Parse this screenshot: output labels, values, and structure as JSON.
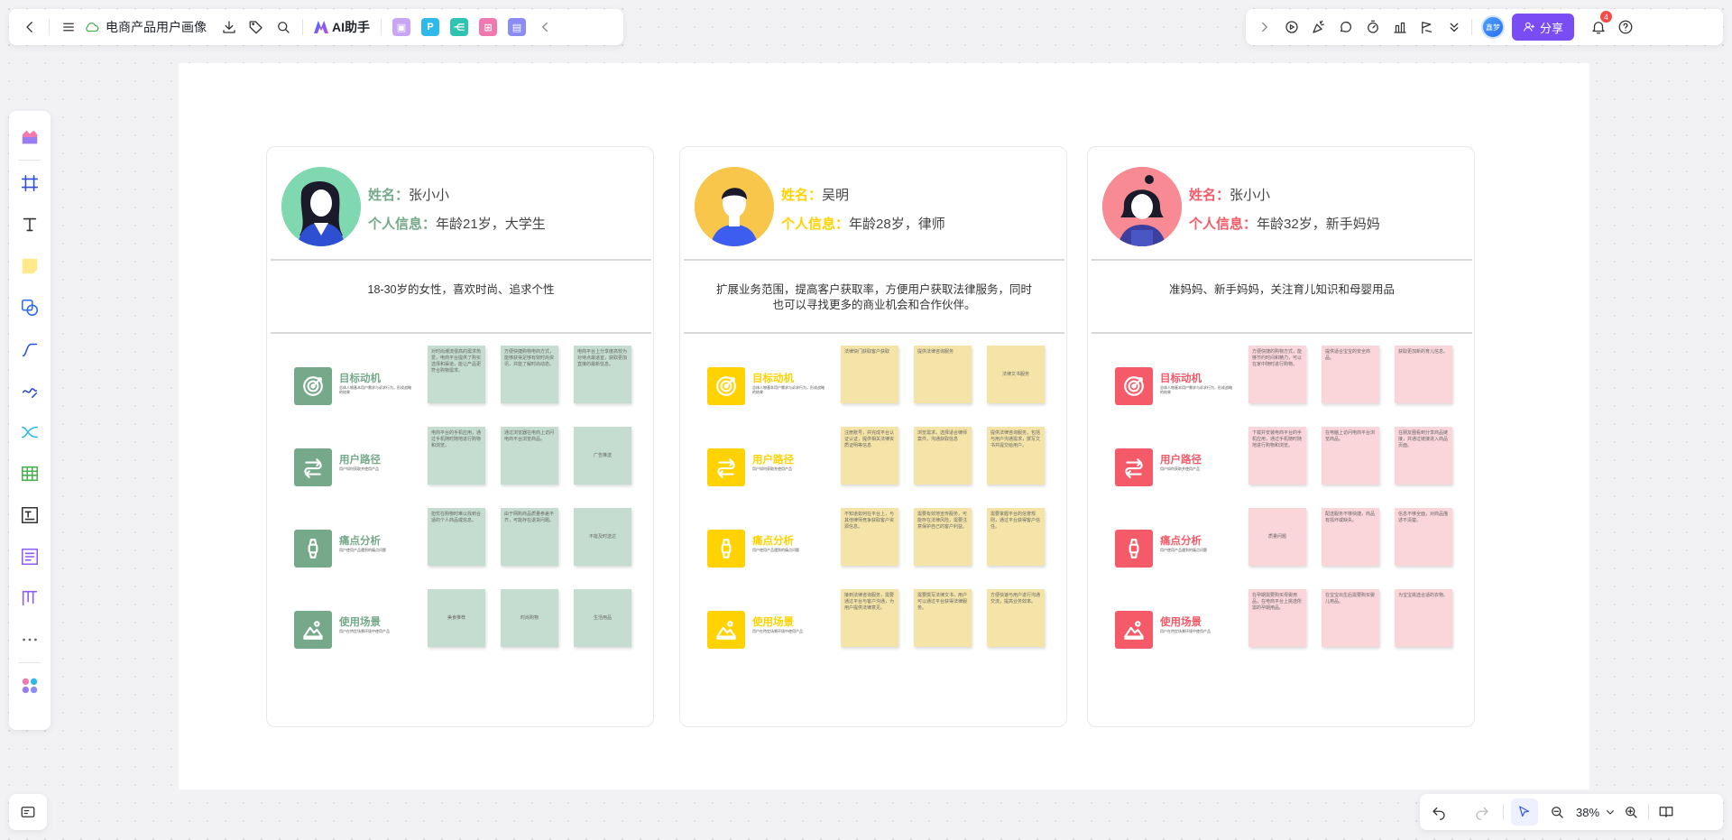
{
  "toolbar": {
    "title": "电商产品用户画像",
    "ai_label": "AI助手",
    "share_label": "分享",
    "avatar_text": "鑫梦",
    "notif_count": "4",
    "zoom": "38%"
  },
  "colors": {
    "green": "#75a98a",
    "yellow": "#ffd200",
    "red": "#f55a68",
    "green_note": "#c5ddd0",
    "yellow_note": "#f5e4a8",
    "red_note": "#fad5da"
  },
  "cards": [
    {
      "name_label": "姓名：",
      "name": "张小小",
      "info_label": "个人信息：",
      "info": "年龄21岁，大学生",
      "desc": "18-30岁的女性，喜欢时尚、追求个性",
      "rows": [
        {
          "title": "目标动机",
          "sub": "总体人物基本用户需求与诉求行为，形成战略的结果",
          "icon": "target-icon",
          "notes": [
            "对时尚潮流很高的需求热爱，电商平台提供了购买选择和渠道，能让产品更符合购物需求。",
            "方便快捷购物电商方式，能够获得足够有效时尚资讯，并能了解时尚动态。",
            "电商平台上分享度高较为对待点最适宜，获取更加直接的最新信息。"
          ]
        },
        {
          "title": "用户路径",
          "sub": "用户如何获取并使用产品",
          "icon": "path-icon",
          "notes": [
            "电商平台的手机应用，通过手机随时随地进行购物和浏览。",
            "通过浏览器在电商上访问电商平台浏览商品。",
            "广告推送"
          ]
        },
        {
          "title": "痛点分析",
          "sub": "用户使用产品遇到的痛点问题",
          "icon": "pain-icon",
          "notes": [
            "担忧在购物时难以找到合适的个人商品或信息。",
            "由于网购商品质量参差不齐，可能存在退货问题。",
            "不能及时送达"
          ]
        },
        {
          "title": "使用场景",
          "sub": "用户在特定场景环境中使用产品",
          "icon": "scene-icon",
          "notes": [
            "美食推荐",
            "时尚购物",
            "生活用品"
          ]
        }
      ]
    },
    {
      "name_label": "姓名：",
      "name": "吴明",
      "info_label": "个人信息：",
      "info": "年龄28岁，律师",
      "desc": "扩展业务范围，提高客户获取率，方便用户获取法律服务，同时也可以寻找更多的商业机会和合作伙伴。",
      "rows": [
        {
          "title": "目标动机",
          "sub": "总体人物基本用户需求与诉求行为，形成战略的结果",
          "icon": "target-icon",
          "notes": [
            "法律快门获取客户获取",
            "提供法律咨询服务",
            "法律文书服务"
          ]
        },
        {
          "title": "用户路径",
          "sub": "用户如何获取并使用产品",
          "icon": "path-icon",
          "notes": [
            "注册账号，并完成平台认证认证，提供相关法律资质证明等信息",
            "浏览需求，选择适合律师案件，沟通获取信息",
            "提供法律咨询服务，包括与用户沟通需求，撰写文书并提交给用户。"
          ]
        },
        {
          "title": "痛点分析",
          "sub": "用户使用产品遇到的痛点问题",
          "icon": "pain-icon",
          "notes": [
            "不知道如何在平台上，与其他律师竞争获取客户资源信息。",
            "需要有效地宣传服务，可能存在法律风险，需要注意保护自己的客户利益。",
            "需要掌握平台的信誉规则，通过平台获得客户信任。"
          ]
        },
        {
          "title": "使用场景",
          "sub": "用户在特定场景环境中使用产品",
          "icon": "scene-icon",
          "notes": [
            "接到法律咨询服务，需要通过平台与客户沟通，为用户提供法律意见。",
            "需要撰写法律文书，用户可以通过平台获得法律服务。",
            "方便快速与用户进行沟通交流，提高业务效率。"
          ]
        }
      ]
    },
    {
      "name_label": "姓名：",
      "name": "张小小",
      "info_label": "个人信息：",
      "info": "年龄32岁，新手妈妈",
      "desc": "准妈妈、新手妈妈，关注育儿知识和母婴用品",
      "rows": [
        {
          "title": "目标动机",
          "sub": "总体人物基本用户需求与诉求行为，形成战略的结果",
          "icon": "target-icon",
          "notes": [
            "方便快捷的购物方式，能够节约时间和精力，可以在家中随时进行购物。",
            "提供适合宝宝的安全商品。",
            "获取更加新的育儿信息。"
          ]
        },
        {
          "title": "用户路径",
          "sub": "用户如何获取并使用产品",
          "icon": "path-icon",
          "notes": [
            "下载并安装电商平台的手机应用，通过手机随时随地进行购物和浏览。",
            "在电脑上访问电商平台浏览商品。",
            "在朋友圈看到分享商品链接，并通过链接进入商品页面。"
          ]
        },
        {
          "title": "痛点分析",
          "sub": "用户使用产品遇到的痛点问题",
          "icon": "pain-icon",
          "notes": [
            "质量问题",
            "配送服务不够快捷，商品有损坏或缺失。",
            "信息不够全面，对商品描述不清楚。"
          ]
        },
        {
          "title": "使用场景",
          "sub": "用户在特定场景环境中使用产品",
          "icon": "scene-icon",
          "notes": [
            "在孕期需要购买母婴用品，在电商平台上挑选所需的孕期用品。",
            "在宝宝出生后需要购买婴儿用品。",
            "为宝宝挑选合适的衣物。"
          ]
        }
      ]
    }
  ]
}
